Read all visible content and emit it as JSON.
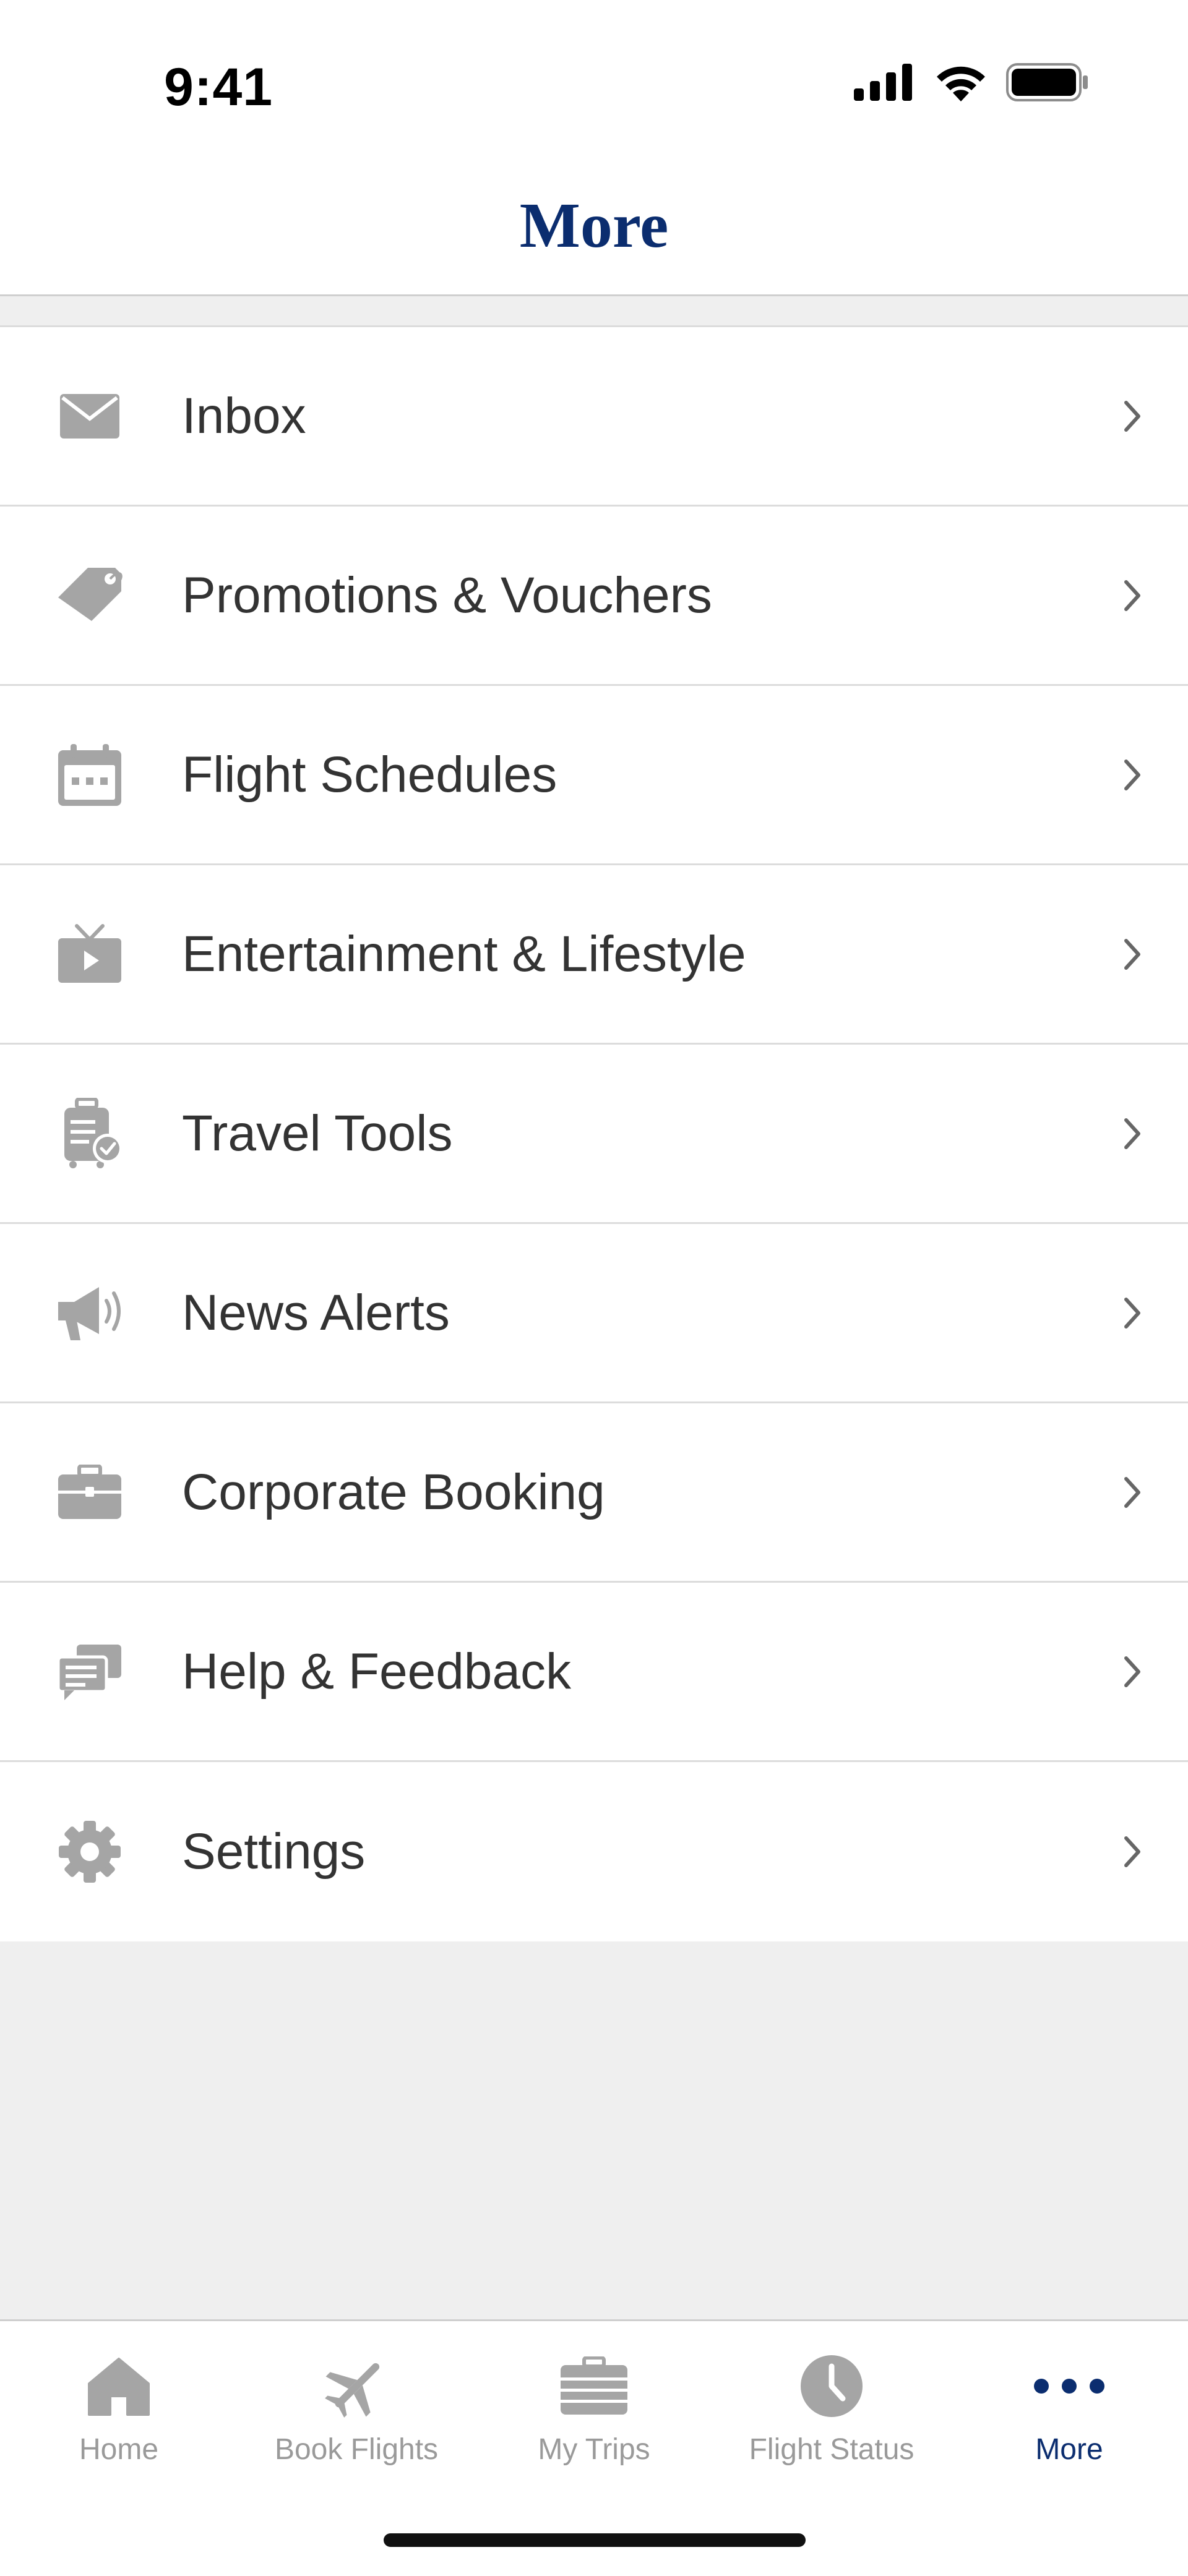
{
  "status_bar": {
    "time": "9:41",
    "icons": [
      "signal-icon",
      "wifi-icon",
      "battery-icon"
    ]
  },
  "header": {
    "title": "More"
  },
  "menu": {
    "items": [
      {
        "label": "Inbox",
        "icon": "envelope-icon"
      },
      {
        "label": "Promotions & Vouchers",
        "icon": "tag-icon"
      },
      {
        "label": "Flight Schedules",
        "icon": "calendar-icon"
      },
      {
        "label": "Entertainment & Lifestyle",
        "icon": "tv-icon"
      },
      {
        "label": "Travel Tools",
        "icon": "luggage-check-icon"
      },
      {
        "label": "News Alerts",
        "icon": "megaphone-icon"
      },
      {
        "label": "Corporate Booking",
        "icon": "briefcase-icon"
      },
      {
        "label": "Help & Feedback",
        "icon": "chat-bubbles-icon"
      },
      {
        "label": "Settings",
        "icon": "gear-icon"
      }
    ]
  },
  "tabbar": {
    "tabs": [
      {
        "label": "Home",
        "icon": "house-icon",
        "active": false
      },
      {
        "label": "Book Flights",
        "icon": "airplane-icon",
        "active": false
      },
      {
        "label": "My Trips",
        "icon": "suitcase-icon",
        "active": false
      },
      {
        "label": "Flight Status",
        "icon": "clock-icon",
        "active": false
      },
      {
        "label": "More",
        "icon": "ellipsis-icon",
        "active": true
      }
    ]
  },
  "colors": {
    "brand_navy": "#0b2d6f",
    "icon_gray": "#a5a5a5",
    "text": "#333333",
    "background": "#efefef"
  }
}
